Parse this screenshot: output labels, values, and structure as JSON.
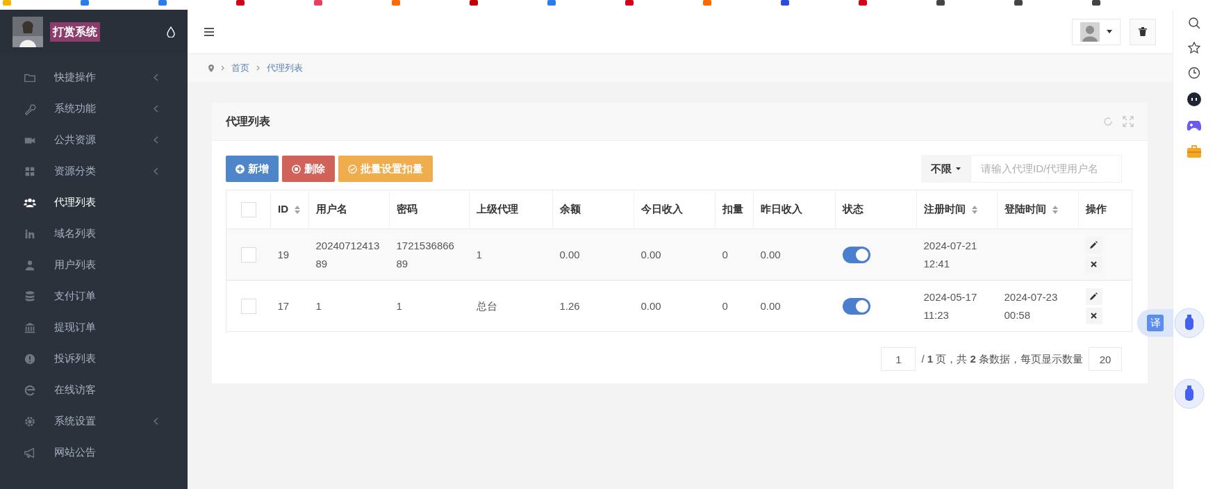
{
  "app": {
    "title": "打赏系统"
  },
  "sidebar": {
    "items": [
      {
        "label": "快捷操作",
        "selected": false,
        "expandable": true
      },
      {
        "label": "系统功能",
        "selected": false,
        "expandable": true
      },
      {
        "label": "公共资源",
        "selected": false,
        "expandable": true
      },
      {
        "label": "资源分类",
        "selected": false,
        "expandable": true
      },
      {
        "label": "代理列表",
        "selected": true,
        "expandable": false
      },
      {
        "label": "域名列表",
        "selected": false,
        "expandable": false
      },
      {
        "label": "用户列表",
        "selected": false,
        "expandable": false
      },
      {
        "label": "支付订单",
        "selected": false,
        "expandable": false
      },
      {
        "label": "提现订单",
        "selected": false,
        "expandable": false
      },
      {
        "label": "投诉列表",
        "selected": false,
        "expandable": false
      },
      {
        "label": "在线访客",
        "selected": false,
        "expandable": false
      },
      {
        "label": "系统设置",
        "selected": false,
        "expandable": true
      },
      {
        "label": "网站公告",
        "selected": false,
        "expandable": false
      }
    ]
  },
  "breadcrumb": [
    "首页",
    "代理列表"
  ],
  "panel": {
    "title": "代理列表",
    "buttons": [
      {
        "label": "新增",
        "kind": "add"
      },
      {
        "label": "删除",
        "kind": "delete"
      },
      {
        "label": "批量设置扣量",
        "kind": "batch"
      }
    ],
    "filter": {
      "label": "不限",
      "placeholder": "请输入代理ID/代理用户名"
    },
    "table": {
      "select_all": {
        "checked": false
      },
      "columns": [
        {
          "label": "ID",
          "sortable": true
        },
        {
          "label": "用户名",
          "sortable": false
        },
        {
          "label": "密码",
          "sortable": false
        },
        {
          "label": "上级代理",
          "sortable": false
        },
        {
          "label": "余额",
          "sortable": false
        },
        {
          "label": "今日收入",
          "sortable": false
        },
        {
          "label": "扣量",
          "sortable": false
        },
        {
          "label": "昨日收入",
          "sortable": false
        },
        {
          "label": "状态",
          "sortable": false
        },
        {
          "label": "注册时间",
          "sortable": true
        },
        {
          "label": "登陆时间",
          "sortable": true
        },
        {
          "label": "操作",
          "sortable": false
        }
      ],
      "rows": [
        {
          "checked": false,
          "cells": [
            "19",
            "2024071241389",
            "172153686689",
            "1",
            "0.00",
            "0.00",
            "0",
            "0.00"
          ],
          "status_on": true,
          "registered": "2024-07-21 12:41",
          "last_login": ""
        },
        {
          "checked": false,
          "cells": [
            "17",
            "1",
            "1",
            "总台",
            "1.26",
            "0.00",
            "0",
            "0.00"
          ],
          "status_on": true,
          "registered": "2024-05-17 11:23",
          "last_login": "2024-07-23 00:58"
        }
      ]
    },
    "pagination": {
      "page": "1",
      "summary": "/ **1** 页，共 **2** 条数据，每页显示数量",
      "page_size": "20"
    }
  },
  "translate_button": {
    "label": "译"
  }
}
